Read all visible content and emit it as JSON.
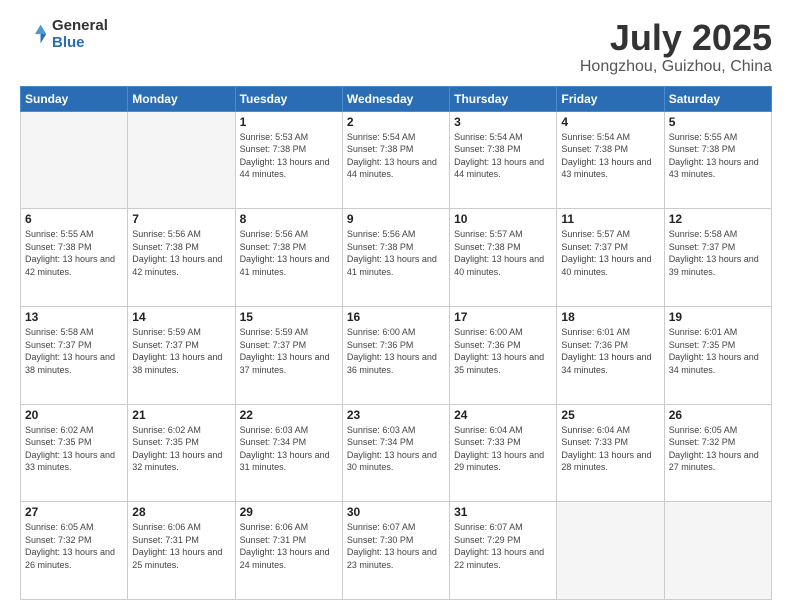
{
  "logo": {
    "general": "General",
    "blue": "Blue"
  },
  "header": {
    "month": "July 2025",
    "location": "Hongzhou, Guizhou, China"
  },
  "weekdays": [
    "Sunday",
    "Monday",
    "Tuesday",
    "Wednesday",
    "Thursday",
    "Friday",
    "Saturday"
  ],
  "weeks": [
    [
      {
        "day": "",
        "empty": true
      },
      {
        "day": "",
        "empty": true
      },
      {
        "day": "1",
        "sunrise": "5:53 AM",
        "sunset": "7:38 PM",
        "daylight": "13 hours and 44 minutes."
      },
      {
        "day": "2",
        "sunrise": "5:54 AM",
        "sunset": "7:38 PM",
        "daylight": "13 hours and 44 minutes."
      },
      {
        "day": "3",
        "sunrise": "5:54 AM",
        "sunset": "7:38 PM",
        "daylight": "13 hours and 44 minutes."
      },
      {
        "day": "4",
        "sunrise": "5:54 AM",
        "sunset": "7:38 PM",
        "daylight": "13 hours and 43 minutes."
      },
      {
        "day": "5",
        "sunrise": "5:55 AM",
        "sunset": "7:38 PM",
        "daylight": "13 hours and 43 minutes."
      }
    ],
    [
      {
        "day": "6",
        "sunrise": "5:55 AM",
        "sunset": "7:38 PM",
        "daylight": "13 hours and 42 minutes."
      },
      {
        "day": "7",
        "sunrise": "5:56 AM",
        "sunset": "7:38 PM",
        "daylight": "13 hours and 42 minutes."
      },
      {
        "day": "8",
        "sunrise": "5:56 AM",
        "sunset": "7:38 PM",
        "daylight": "13 hours and 41 minutes."
      },
      {
        "day": "9",
        "sunrise": "5:56 AM",
        "sunset": "7:38 PM",
        "daylight": "13 hours and 41 minutes."
      },
      {
        "day": "10",
        "sunrise": "5:57 AM",
        "sunset": "7:38 PM",
        "daylight": "13 hours and 40 minutes."
      },
      {
        "day": "11",
        "sunrise": "5:57 AM",
        "sunset": "7:37 PM",
        "daylight": "13 hours and 40 minutes."
      },
      {
        "day": "12",
        "sunrise": "5:58 AM",
        "sunset": "7:37 PM",
        "daylight": "13 hours and 39 minutes."
      }
    ],
    [
      {
        "day": "13",
        "sunrise": "5:58 AM",
        "sunset": "7:37 PM",
        "daylight": "13 hours and 38 minutes."
      },
      {
        "day": "14",
        "sunrise": "5:59 AM",
        "sunset": "7:37 PM",
        "daylight": "13 hours and 38 minutes."
      },
      {
        "day": "15",
        "sunrise": "5:59 AM",
        "sunset": "7:37 PM",
        "daylight": "13 hours and 37 minutes."
      },
      {
        "day": "16",
        "sunrise": "6:00 AM",
        "sunset": "7:36 PM",
        "daylight": "13 hours and 36 minutes."
      },
      {
        "day": "17",
        "sunrise": "6:00 AM",
        "sunset": "7:36 PM",
        "daylight": "13 hours and 35 minutes."
      },
      {
        "day": "18",
        "sunrise": "6:01 AM",
        "sunset": "7:36 PM",
        "daylight": "13 hours and 34 minutes."
      },
      {
        "day": "19",
        "sunrise": "6:01 AM",
        "sunset": "7:35 PM",
        "daylight": "13 hours and 34 minutes."
      }
    ],
    [
      {
        "day": "20",
        "sunrise": "6:02 AM",
        "sunset": "7:35 PM",
        "daylight": "13 hours and 33 minutes."
      },
      {
        "day": "21",
        "sunrise": "6:02 AM",
        "sunset": "7:35 PM",
        "daylight": "13 hours and 32 minutes."
      },
      {
        "day": "22",
        "sunrise": "6:03 AM",
        "sunset": "7:34 PM",
        "daylight": "13 hours and 31 minutes."
      },
      {
        "day": "23",
        "sunrise": "6:03 AM",
        "sunset": "7:34 PM",
        "daylight": "13 hours and 30 minutes."
      },
      {
        "day": "24",
        "sunrise": "6:04 AM",
        "sunset": "7:33 PM",
        "daylight": "13 hours and 29 minutes."
      },
      {
        "day": "25",
        "sunrise": "6:04 AM",
        "sunset": "7:33 PM",
        "daylight": "13 hours and 28 minutes."
      },
      {
        "day": "26",
        "sunrise": "6:05 AM",
        "sunset": "7:32 PM",
        "daylight": "13 hours and 27 minutes."
      }
    ],
    [
      {
        "day": "27",
        "sunrise": "6:05 AM",
        "sunset": "7:32 PM",
        "daylight": "13 hours and 26 minutes."
      },
      {
        "day": "28",
        "sunrise": "6:06 AM",
        "sunset": "7:31 PM",
        "daylight": "13 hours and 25 minutes."
      },
      {
        "day": "29",
        "sunrise": "6:06 AM",
        "sunset": "7:31 PM",
        "daylight": "13 hours and 24 minutes."
      },
      {
        "day": "30",
        "sunrise": "6:07 AM",
        "sunset": "7:30 PM",
        "daylight": "13 hours and 23 minutes."
      },
      {
        "day": "31",
        "sunrise": "6:07 AM",
        "sunset": "7:29 PM",
        "daylight": "13 hours and 22 minutes."
      },
      {
        "day": "",
        "empty": true
      },
      {
        "day": "",
        "empty": true
      }
    ]
  ],
  "labels": {
    "sunrise": "Sunrise:",
    "sunset": "Sunset:",
    "daylight": "Daylight:"
  }
}
